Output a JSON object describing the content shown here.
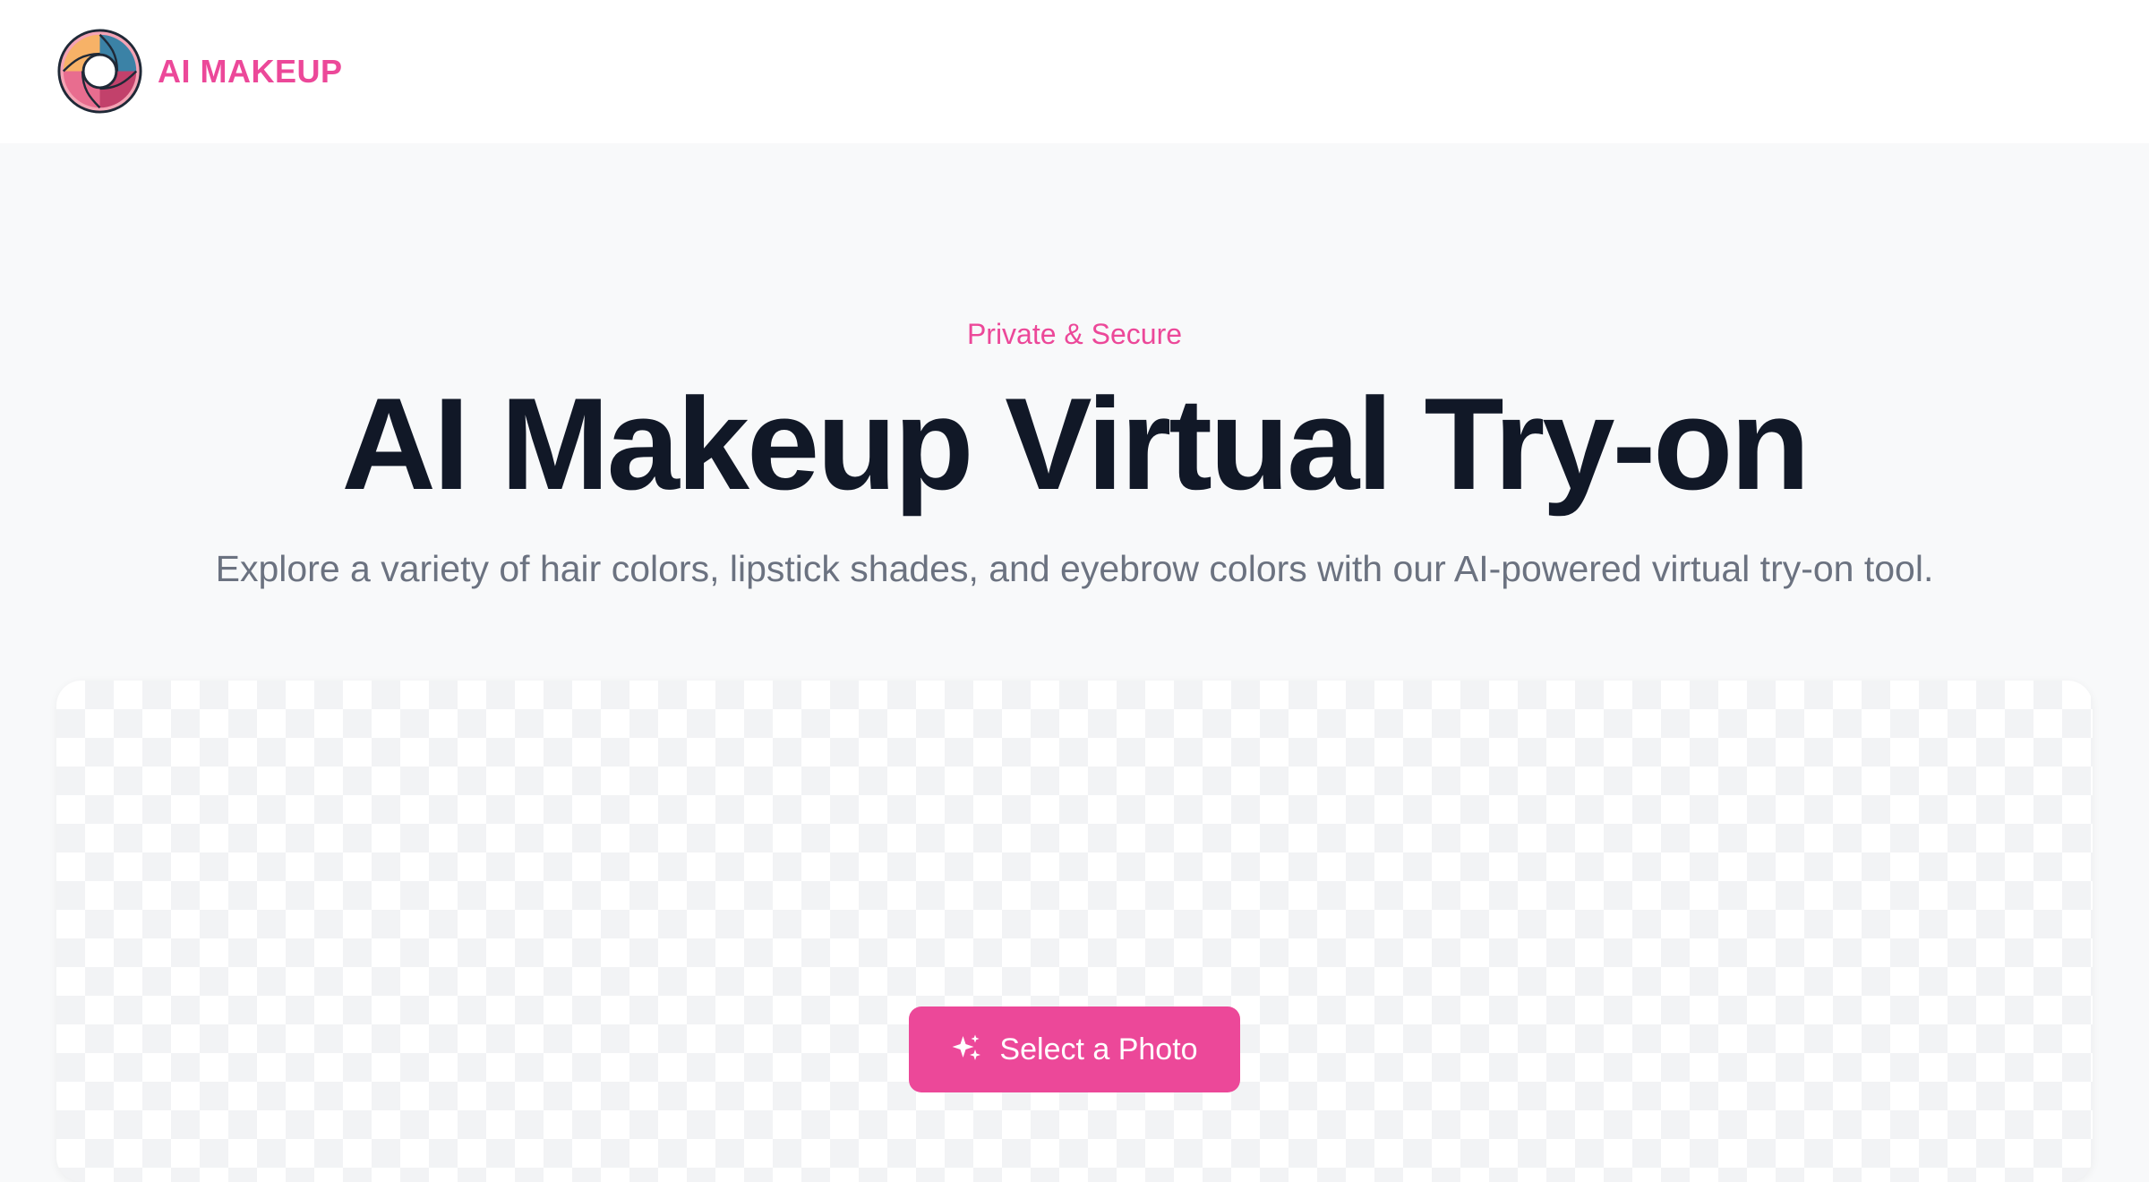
{
  "brand": {
    "name": "AI MAKEUP",
    "logo_icon": "camera-aperture-icon",
    "color": "#ec4899"
  },
  "hero": {
    "eyebrow": "Private & Secure",
    "title": "AI Makeup Virtual Try-on",
    "subtitle": "Explore a variety of hair colors, lipstick shades, and eyebrow colors with our AI-powered virtual try-on tool."
  },
  "upload": {
    "button_label": "Select a Photo",
    "button_icon": "sparkle-icon",
    "button_color": "#ec4899"
  }
}
